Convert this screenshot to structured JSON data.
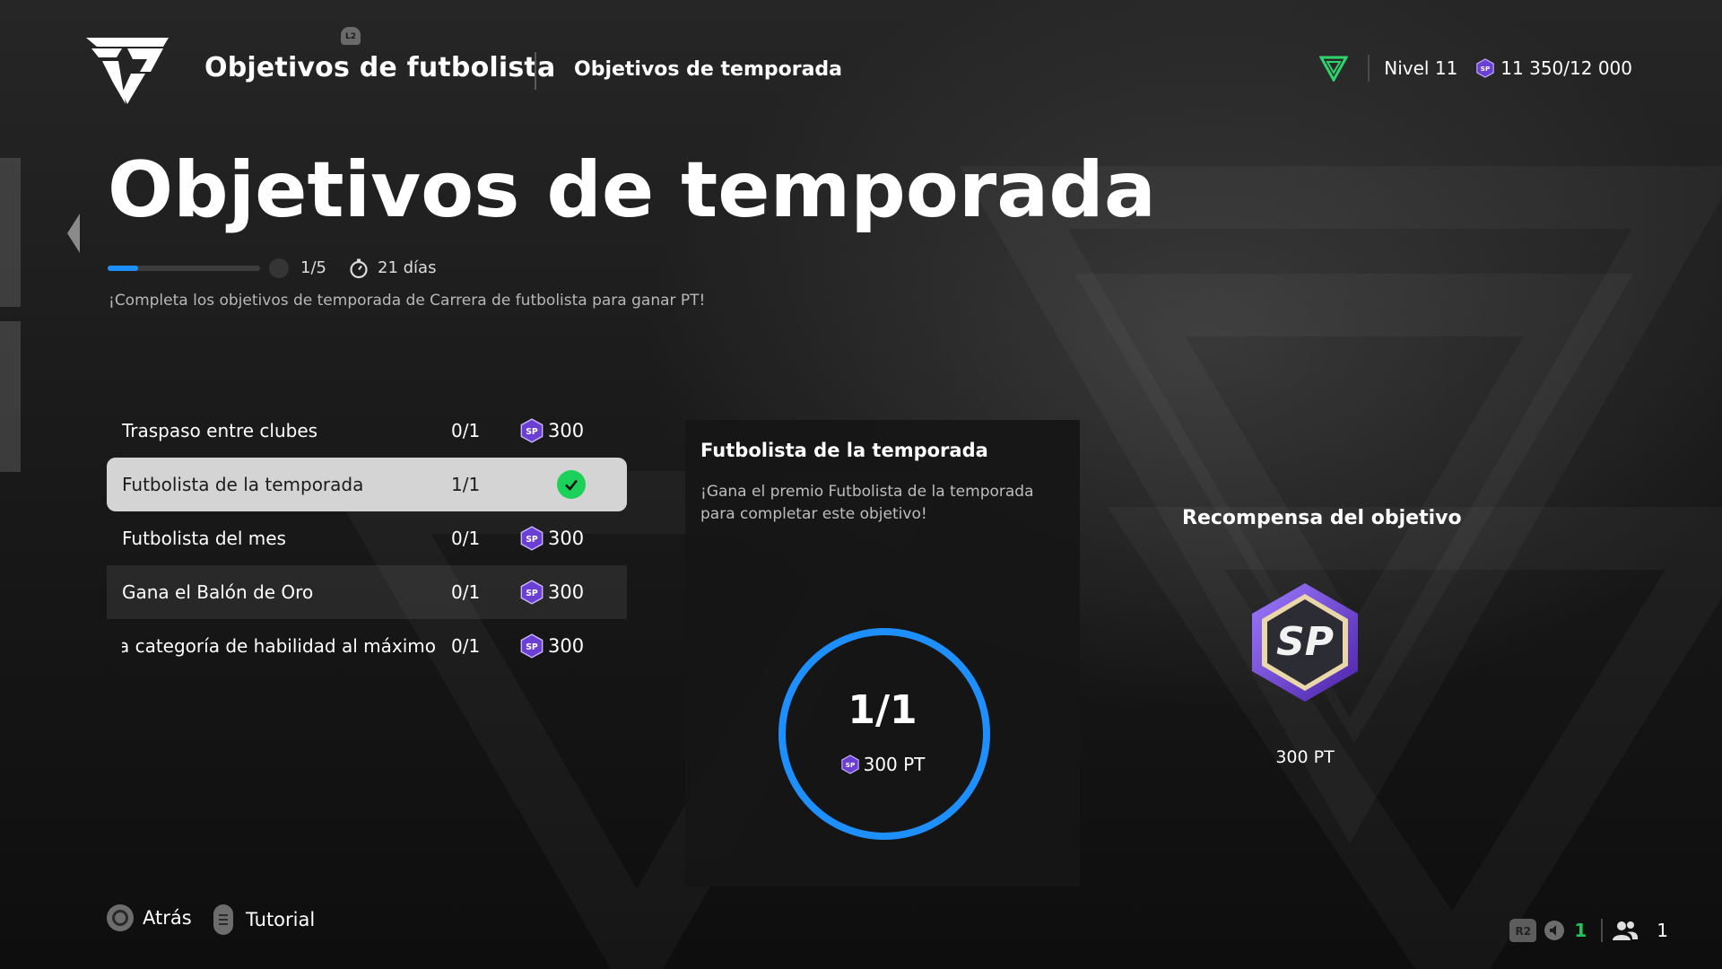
{
  "header": {
    "title": "Objetivos de futbolista",
    "subtitle": "Objetivos de temporada",
    "l2_hint": "L2",
    "level": "Nivel 11",
    "points": "11 350/12 000"
  },
  "hero": {
    "title": "Objetivos de temporada",
    "progress_fraction": 0.2,
    "progress_text": "1/5",
    "days": "21 días",
    "description": "¡Completa los objetivos de temporada de Carrera de futbolista para ganar PT!"
  },
  "objectives": [
    {
      "name": "Traspaso entre clubes",
      "count": "0/1",
      "reward": "300",
      "completed": false
    },
    {
      "name": "Futbolista de la temporada",
      "count": "1/1",
      "reward": "",
      "completed": true
    },
    {
      "name": "Futbolista del mes",
      "count": "0/1",
      "reward": "300",
      "completed": false
    },
    {
      "name": "Gana el Balón de Oro",
      "count": "0/1",
      "reward": "300",
      "completed": false
    },
    {
      "name": "ia categoría de habilidad al máximo",
      "count": "0/1",
      "reward": "300",
      "completed": false
    }
  ],
  "detail": {
    "title": "Futbolista de la temporada",
    "description": "¡Gana el premio Futbolista de la temporada para completar este objetivo!",
    "progress": "1/1",
    "progress_fraction": 1.0,
    "points": "300 PT"
  },
  "reward": {
    "title": "Recompensa del objetivo",
    "badge_text": "SP",
    "points": "300 PT"
  },
  "footer": {
    "back_label": "Atrás",
    "tutorial_label": "Tutorial",
    "r2_hint": "R2",
    "online_count": "1",
    "party_count": "1"
  },
  "colors": {
    "accent_blue": "#1e8fff",
    "check_green": "#1cd15a",
    "sp_purple": "#6b3fd4",
    "rank_green": "#2fd46b"
  },
  "icons": [
    "fc-logo",
    "rank-shield-icon",
    "sp-coin-icon",
    "timer-icon",
    "check-icon",
    "circle-button-icon",
    "touchpad-button-icon",
    "speaker-icon",
    "people-icon"
  ]
}
